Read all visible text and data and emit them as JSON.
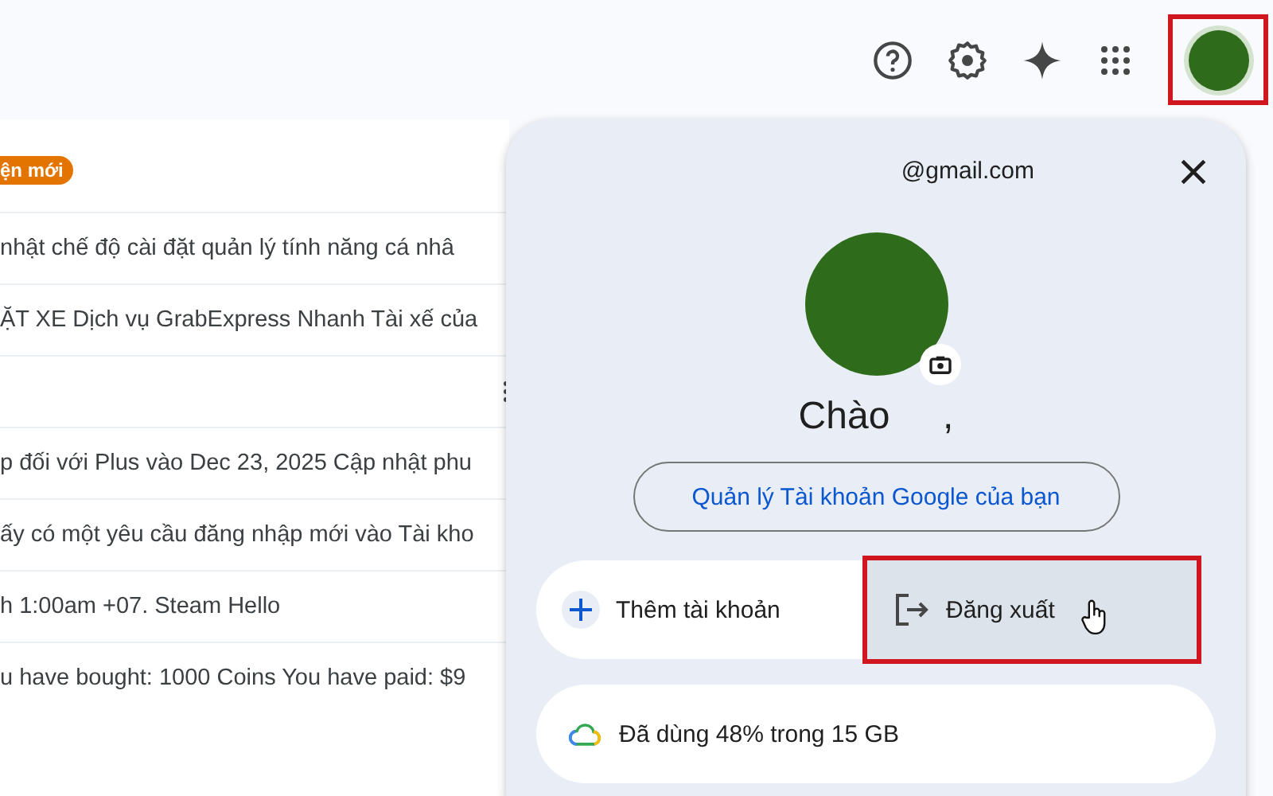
{
  "top_bar": {
    "avatar": {
      "highlighted": true
    }
  },
  "mail_list": {
    "badge": "ện mới",
    "rows": [
      {
        "kind": "text",
        "text": "nhật chế độ cài đặt quản lý tính năng cá nhâ"
      },
      {
        "kind": "text",
        "text": "ẶT XE Dịch vụ GrabExpress Nhanh Tài xế của"
      },
      {
        "kind": "hover",
        "text": ""
      },
      {
        "kind": "text",
        "text": "p đối với Plus vào Dec 23, 2025 Cập nhật phu"
      },
      {
        "kind": "text",
        "text": "ấy có một yêu cầu đăng nhập mới vào Tài kho"
      },
      {
        "kind": "text",
        "text": "h 1:00am +07. Steam Hello"
      },
      {
        "kind": "text",
        "text": "u have bought: 1000 Coins You have paid: $9"
      }
    ]
  },
  "account_panel": {
    "email": "@gmail.com",
    "greeting": "Chào     ,",
    "manage_button": "Quản lý Tài khoản Google của bạn",
    "actions": [
      {
        "kind": "add",
        "label": "Thêm tài khoản",
        "highlighted": false
      },
      {
        "kind": "signout",
        "label": "Đăng xuất",
        "highlighted": true
      }
    ],
    "storage": "Đã dùng 48% trong 15 GB"
  }
}
